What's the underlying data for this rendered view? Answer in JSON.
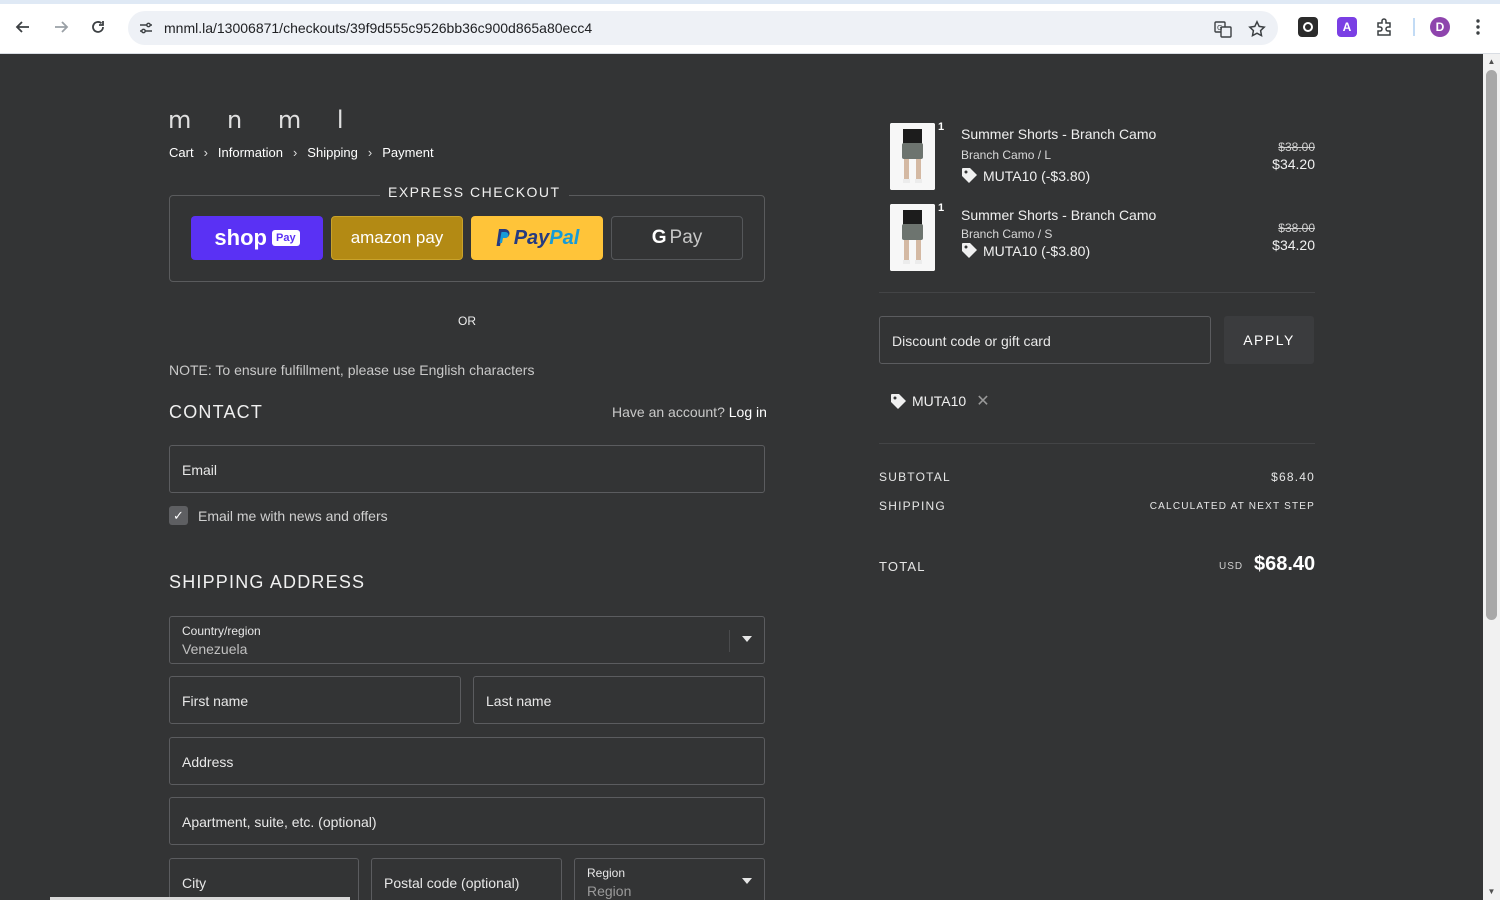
{
  "browser": {
    "url": "mnml.la/13006871/checkouts/39f9d555c9526bb36c900d865a80ecc4",
    "profile_initial": "D",
    "extension_letter": "A"
  },
  "logo": "m n m l",
  "breadcrumbs": [
    "Cart",
    "Information",
    "Shipping",
    "Payment"
  ],
  "express": {
    "title": "EXPRESS CHECKOUT",
    "shoppay": "shop",
    "shoppay_badge": "Pay",
    "amazonpay": "amazon pay",
    "paypal_p": "Pay",
    "paypal_pal": "Pal",
    "gpay_g": "G",
    "gpay": "Pay"
  },
  "or_label": "OR",
  "note": "NOTE: To ensure fulfillment, please use English characters",
  "contact": {
    "heading": "CONTACT",
    "have_account": "Have an account?",
    "login": "Log in",
    "email_placeholder": "Email",
    "newsletter_label": "Email me with news and offers",
    "newsletter_checked": true
  },
  "shipping": {
    "heading": "SHIPPING ADDRESS",
    "country_label": "Country/region",
    "country_value": "Venezuela",
    "first_name": "First name",
    "last_name": "Last name",
    "address": "Address",
    "apartment": "Apartment, suite, etc. (optional)",
    "city": "City",
    "postal": "Postal code (optional)",
    "region_label": "Region",
    "region_value": "Region"
  },
  "cart": {
    "items": [
      {
        "qty": "1",
        "title": "Summer Shorts - Branch Camo",
        "variant": "Branch Camo / L",
        "discount": "MUTA10 (-$3.80)",
        "original_price": "$38.00",
        "price": "$34.20"
      },
      {
        "qty": "1",
        "title": "Summer Shorts - Branch Camo",
        "variant": "Branch Camo / S",
        "discount": "MUTA10 (-$3.80)",
        "original_price": "$38.00",
        "price": "$34.20"
      }
    ],
    "discount_placeholder": "Discount code or gift card",
    "apply_label": "APPLY",
    "applied_code": "MUTA10",
    "subtotal_label": "SUBTOTAL",
    "subtotal_value": "$68.40",
    "shipping_label": "SHIPPING",
    "shipping_value": "CALCULATED AT NEXT STEP",
    "total_label": "TOTAL",
    "currency": "USD",
    "total_value": "$68.40"
  },
  "colors": {
    "background": "#333435",
    "shoppay": "#5a31f4",
    "amazonpay": "#b38a14",
    "paypal": "#ffc439"
  }
}
